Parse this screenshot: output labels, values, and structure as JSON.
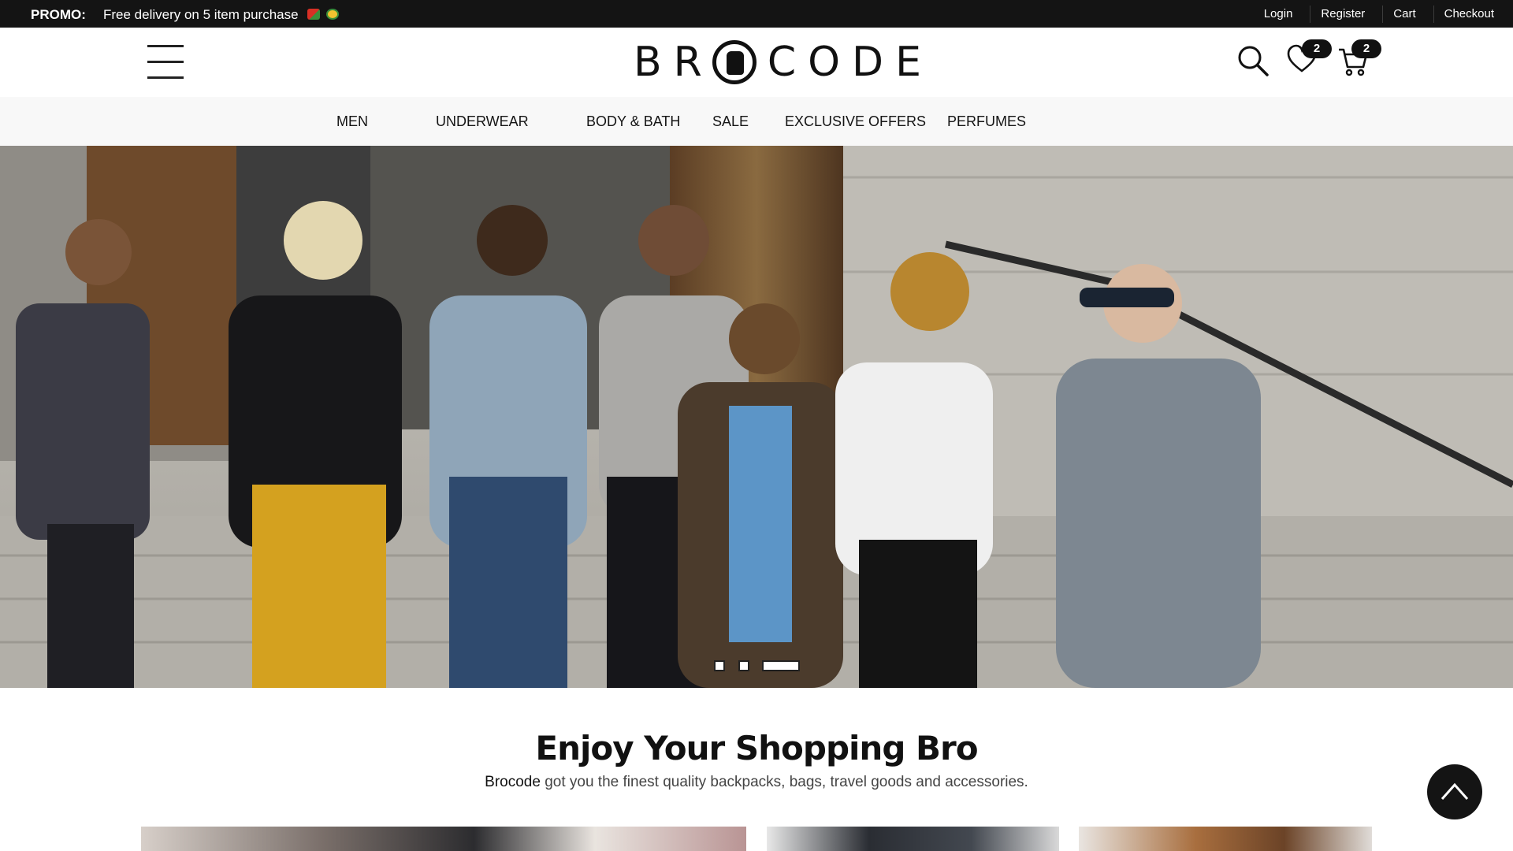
{
  "promo": {
    "label": "PROMO:",
    "text": "Free delivery on 5 item purchase"
  },
  "top_links": [
    "Login",
    "Register",
    "Cart",
    "Checkout"
  ],
  "header": {
    "logo_text": "BRCODE",
    "logo_left": "BR",
    "logo_right": "CODE",
    "wishlist_count": "2",
    "cart_count": "2"
  },
  "nav": {
    "items": [
      "MEN",
      "UNDERWEAR",
      "BODY & BATH",
      "SALE",
      "EXCLUSIVE OFFERS",
      "PERFUMES"
    ]
  },
  "hero": {
    "slide_count": 3,
    "active_slide": 3
  },
  "intro": {
    "title": "Enjoy Your Shopping Bro",
    "brand": "Brocode",
    "text": " got you the finest quality backpacks, bags, travel goods and accessories."
  },
  "icons": {
    "menu": "hamburger-icon",
    "search": "search-icon",
    "wishlist": "heart-icon",
    "cart": "cart-icon",
    "back_to_top": "chevron-up-icon"
  },
  "colors": {
    "bar": "#141414",
    "nav_bg": "#f8f8f8",
    "accent": "#111111"
  }
}
